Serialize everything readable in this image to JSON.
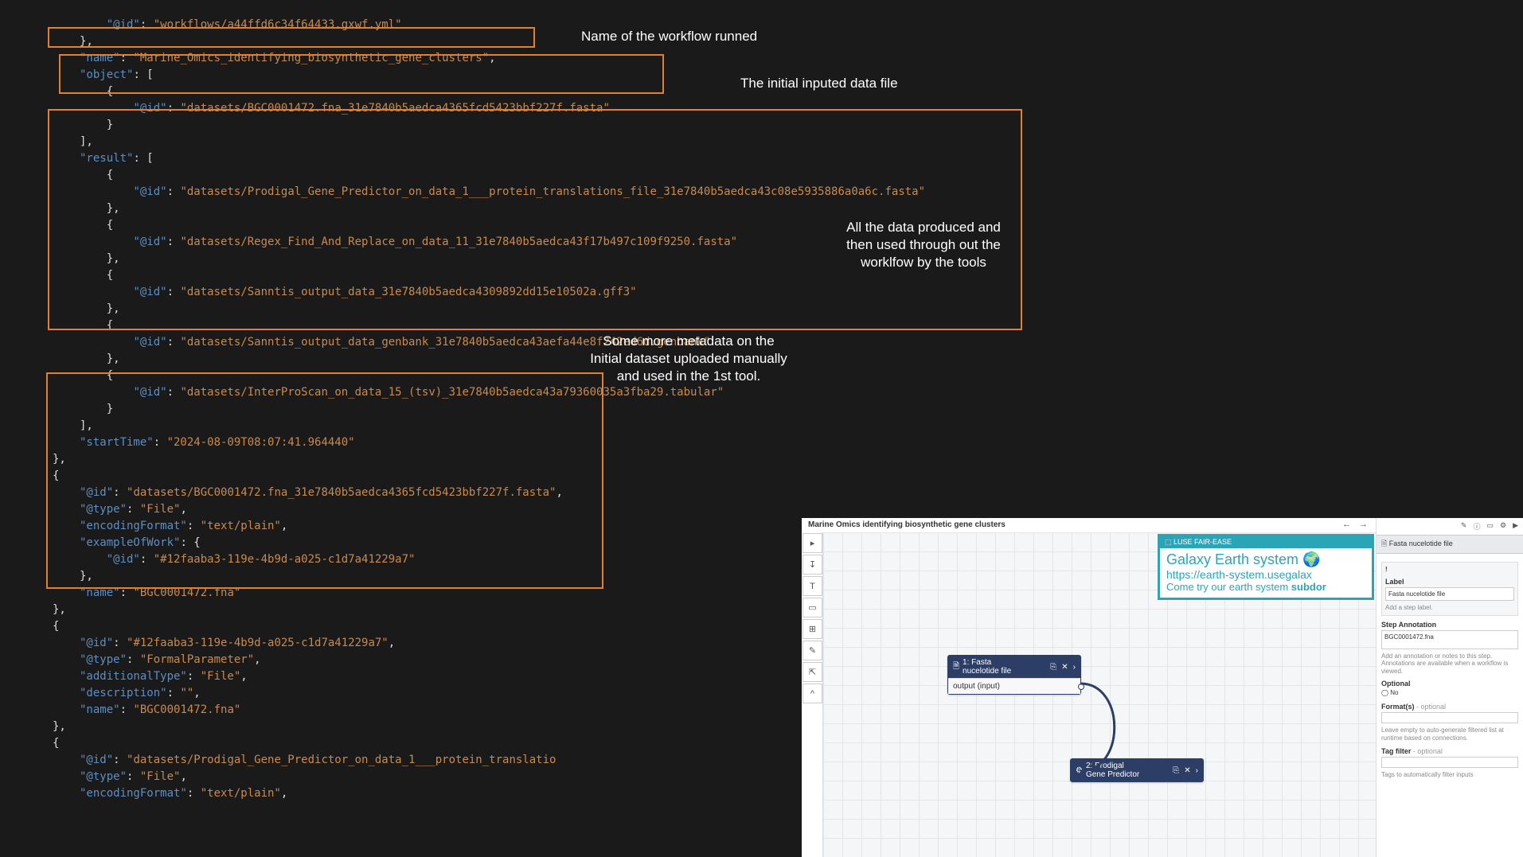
{
  "code": {
    "l1a": "\"@id\"",
    "l1b": "\"workflows/a44ffd6c34f64433.gxwf.yml\"",
    "l2": "},",
    "l3a": "\"name\"",
    "l3b": "\"Marine_Omics_identifying_biosynthetic_gene_clusters\"",
    "l4a": "\"object\"",
    "l4b": ": [",
    "l5": "{",
    "l6a": "\"@id\"",
    "l6b": "\"datasets/BGC0001472.fna_31e7840b5aedca4365fcd5423bbf227f.fasta\"",
    "l7": "}",
    "l8": "],",
    "l9a": "\"result\"",
    "l9b": ": [",
    "l10": "{",
    "l11a": "\"@id\"",
    "l11b": "\"datasets/Prodigal_Gene_Predictor_on_data_1___protein_translations_file_31e7840b5aedca43c08e5935886a0a6c.fasta\"",
    "l12": "},",
    "l13": "{",
    "l14a": "\"@id\"",
    "l14b": "\"datasets/Regex_Find_And_Replace_on_data_11_31e7840b5aedca43f17b497c109f9250.fasta\"",
    "l15": "},",
    "l16": "{",
    "l17a": "\"@id\"",
    "l17b": "\"datasets/Sanntis_output_data_31e7840b5aedca4309892dd15e10502a.gff3\"",
    "l18": "},",
    "l19": "{",
    "l20a": "\"@id\"",
    "l20b": "\"datasets/Sanntis_output_data_genbank_31e7840b5aedca43aefa44e8f242ed6d.genbank\"",
    "l21": "},",
    "l22": "{",
    "l23a": "\"@id\"",
    "l23b": "\"datasets/InterProScan_on_data_15_(tsv)_31e7840b5aedca43a79360035a3fba29.tabular\"",
    "l24": "}",
    "l25": "],",
    "l26a": "\"startTime\"",
    "l26b": "\"2024-08-09T08:07:41.964440\"",
    "l27": "},",
    "l28": "{",
    "l29a": "\"@id\"",
    "l29b": "\"datasets/BGC0001472.fna_31e7840b5aedca4365fcd5423bbf227f.fasta\"",
    "l30a": "\"@type\"",
    "l30b": "\"File\"",
    "l31a": "\"encodingFormat\"",
    "l31b": "\"text/plain\"",
    "l32a": "\"exampleOfWork\"",
    "l32b": ": {",
    "l33a": "\"@id\"",
    "l33b": "\"#12faaba3-119e-4b9d-a025-c1d7a41229a7\"",
    "l34": "},",
    "l35a": "\"name\"",
    "l35b": "\"BGC0001472.fna\"",
    "l36": "},",
    "l37": "{",
    "l38a": "\"@id\"",
    "l38b": "\"#12faaba3-119e-4b9d-a025-c1d7a41229a7\"",
    "l39a": "\"@type\"",
    "l39b": "\"FormalParameter\"",
    "l40a": "\"additionalType\"",
    "l40b": "\"File\"",
    "l41a": "\"description\"",
    "l41b": "\"\"",
    "l42a": "\"name\"",
    "l42b": "\"BGC0001472.fna\"",
    "l43": "},",
    "l44": "{",
    "l45a": "\"@id\"",
    "l45b": "\"datasets/Prodigal_Gene_Predictor_on_data_1___protein_translatio",
    "l46a": "\"@type\"",
    "l46b": "\"File\"",
    "l47a": "\"encodingFormat\"",
    "l47b": "\"text/plain\""
  },
  "annotations": {
    "a1": "Name of the workflow runned",
    "a2": "The initial inputed data file",
    "a3": "All the data produced and\nthen used through out the\nworklfow by the tools",
    "a4": "Some more metadata on the\nInitial dataset uploaded manually\nand used in the 1st tool."
  },
  "galaxy": {
    "title": "Marine Omics identifying biosynthetic gene clusters",
    "nav_back": "←",
    "nav_fwd": "→",
    "banner_top": "⬚ LUSE FAIR-EASE",
    "banner_title": "Galaxy Earth system 🌍",
    "banner_link": "https://earth-system.usegalax",
    "banner_sub": "Come try our earth system ",
    "banner_sub2": "subdor",
    "node1_title": "1: Fasta\nnucelotide file",
    "node1_body": "output (input)",
    "node2_title": "2: Prodigal\nGene Predictor",
    "sidepanel": {
      "header": "Fasta nucelotide file",
      "warn": "!",
      "label_label": "Label",
      "label_value": "Fasta nucelotide file",
      "label_placeholder": "Add a step label.",
      "annotation_label": "Step Annotation",
      "annotation_value": "BGC0001472.fna",
      "annotation_help": "Add an annotation or notes to this step. Annotations are available when a workflow is viewed.",
      "optional_label": "Optional",
      "optional_value": "No",
      "formats_label": "Format(s)",
      "formats_suffix": "- optional",
      "formats_help": "Leave empty to auto-generate filtered list at runtime based on connections.",
      "tagfilter_label": "Tag filter",
      "tagfilter_suffix": "- optional",
      "tagfilter_help": "Tags to automatically filter inputs"
    },
    "toolbar": [
      "▸",
      "↧",
      "T",
      "▭",
      "⊞",
      "✎",
      "⇱",
      "^"
    ]
  }
}
